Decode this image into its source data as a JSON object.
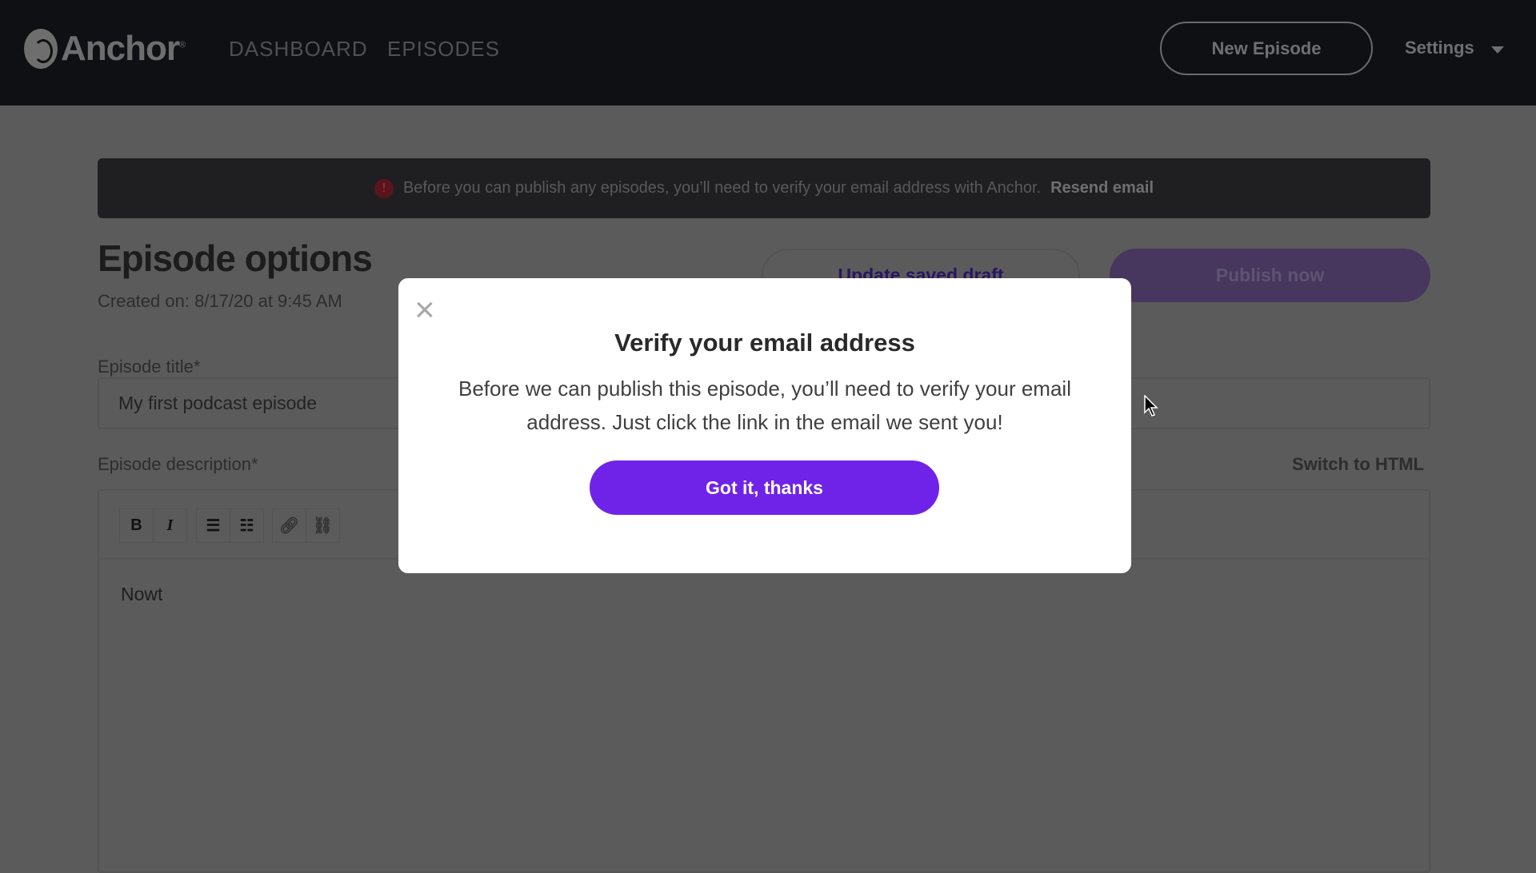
{
  "header": {
    "brand": "Anchor",
    "nav": [
      "DASHBOARD",
      "EPISODES"
    ],
    "new_episode": "New Episode",
    "settings": "Settings"
  },
  "banner": {
    "text": "Before you can publish any episodes, you’ll need to verify your email address with Anchor.",
    "link": "Resend email",
    "icon": "alert-icon"
  },
  "page": {
    "title": "Episode options",
    "created": "Created on: 8/17/20 at 9:45 AM",
    "update_draft": "Update saved draft",
    "publish_now": "Publish now",
    "title_label": "Episode title*",
    "title_value": "My first podcast episode",
    "description_label": "Episode description*",
    "switch_html": "Switch to HTML",
    "description_value": "Nowt",
    "toolbar": {
      "bold": "B",
      "italic": "I"
    }
  },
  "modal": {
    "title": "Verify your email address",
    "text": "Before we can publish this episode, you’ll need to verify your email address. Just click the link in the email we sent you!",
    "button": "Got it, thanks",
    "close": "×"
  },
  "colors": {
    "accent": "#7023e8",
    "header": "#0f1014"
  }
}
